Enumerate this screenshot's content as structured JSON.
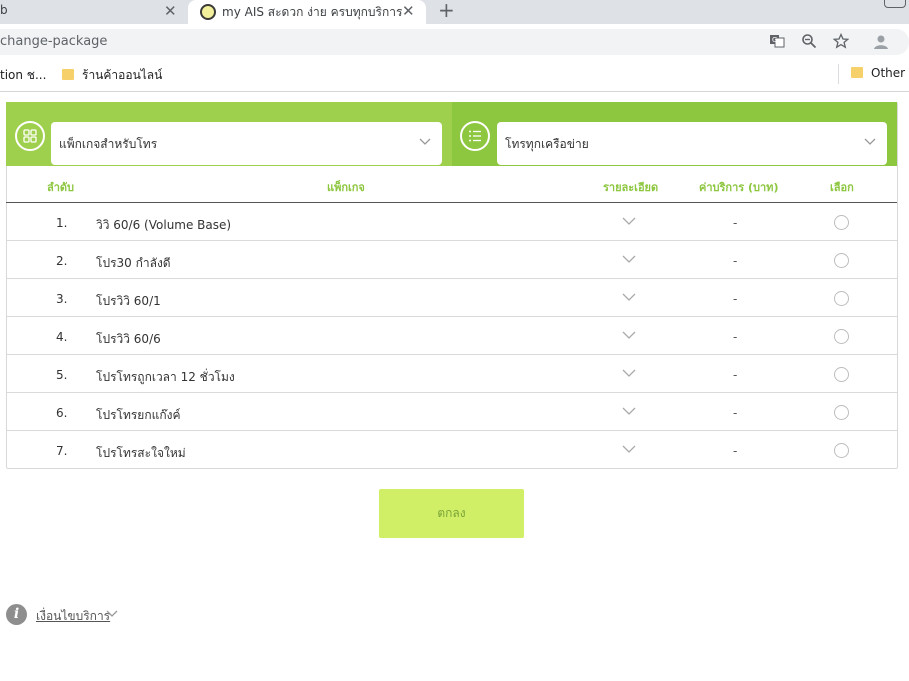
{
  "browser": {
    "tabs": [
      {
        "title": "b"
      },
      {
        "title": "my AIS สะดวก ง่าย ครบทุกบริการ"
      }
    ],
    "address": "change-package",
    "bookmarks": [
      {
        "label": "tion ช..."
      },
      {
        "label": "ร้านค้าออนไลน์"
      },
      {
        "label": "Other b"
      }
    ]
  },
  "filters": {
    "category": {
      "selected": "แพ็กเกจสำหรับโทร"
    },
    "subcategory": {
      "selected": "โทรทุกเครือข่าย"
    }
  },
  "table": {
    "headers": {
      "index": "ลำดับ",
      "package": "แพ็กเกจ",
      "details": "รายละเอียด",
      "price": "ค่าบริการ (บาท)",
      "select": "เลือก"
    },
    "rows": [
      {
        "num": "1.",
        "name": "วิวิ 60/6 (Volume Base)",
        "price": "-",
        "selected": false
      },
      {
        "num": "2.",
        "name": "โปร30 กำลังดี",
        "price": "-",
        "selected": false
      },
      {
        "num": "3.",
        "name": "โปรวิวิ 60/1",
        "price": "-",
        "selected": false
      },
      {
        "num": "4.",
        "name": "โปรวิวิ 60/6",
        "price": "-",
        "selected": false
      },
      {
        "num": "5.",
        "name": "โปรโทรถูกเวลา 12 ชั่วโมง",
        "price": "-",
        "selected": false
      },
      {
        "num": "6.",
        "name": "โปรโทรยกแก๊งค์",
        "price": "-",
        "selected": false
      },
      {
        "num": "7.",
        "name": "โปรโทรสะใจใหม่",
        "price": "-",
        "selected": false
      }
    ]
  },
  "actions": {
    "ok": "ตกลง"
  },
  "footer": {
    "terms": "เงื่อนไขบริการ"
  },
  "colors": {
    "brand_green": "#8dc63f",
    "button_green": "#d0ef66",
    "header_text": "#8dc63f"
  },
  "icons": {
    "category": "grid-icon",
    "subcategory": "list-icon",
    "info": "info-icon"
  }
}
